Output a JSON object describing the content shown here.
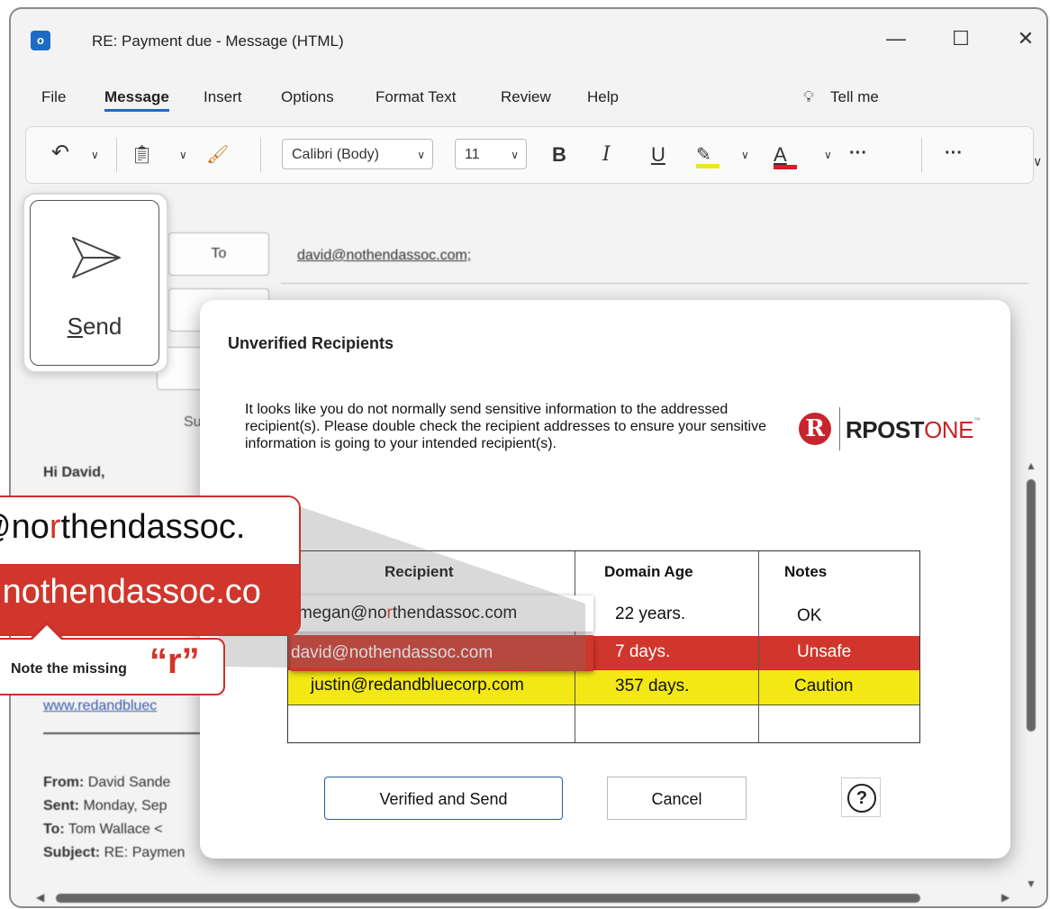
{
  "window": {
    "title": "RE: Payment due  -  Message (HTML)",
    "controls": {
      "minimize": "—",
      "maximize": "☐",
      "close": "✕"
    }
  },
  "menu": [
    "File",
    "Message",
    "Insert",
    "Options",
    "Format Text",
    "Review",
    "Help"
  ],
  "tell_me": "Tell me",
  "ribbon": {
    "font_name": "Calibri (Body)",
    "font_size": "11",
    "bold": "B",
    "italic": "I",
    "underline": "U",
    "font_color": "A",
    "more": "···",
    "more2": "···",
    "highlight_color": "#e9e81c",
    "font_color_bar": "#d21f2a"
  },
  "compose": {
    "to_button": "To",
    "to_address": "david@nothendassoc.com;",
    "subject_stub": "Su",
    "body": {
      "greeting": "Hi David,",
      "link": "www.redandbluec",
      "from_label": "From:",
      "from_value": "David Sande",
      "sent_label": "Sent:",
      "sent_value": "Monday, Sep",
      "to_label": "To:",
      "to_value": "Tom Wallace <",
      "subject_label": "Subject:",
      "subject_value": "RE: Paymen"
    }
  },
  "send": {
    "label": "Send"
  },
  "dialog": {
    "title": "Unverified Recipients",
    "message": "It looks like you do not normally send sensitive information to the addressed recipient(s). Please double check the recipient addresses to ensure your sensitive information is going to your intended recipient(s).",
    "logo": {
      "mark": "R",
      "text_dark": "RPOST",
      "text_red": "ONE",
      "tm": "™"
    },
    "table": {
      "headers": [
        "Recipient",
        "Domain Age",
        "Notes"
      ],
      "rows": [
        {
          "recipient_a": "megan@no",
          "recipient_b": "r",
          "recipient_c": "thendassoc.com",
          "age": "22 years.",
          "note": "OK",
          "status": "ok"
        },
        {
          "recipient": "david@nothendassoc.com",
          "age": "7 days.",
          "note": "Unsafe",
          "status": "unsafe"
        },
        {
          "recipient": "justin@redandbluecorp.com",
          "age": "357 days.",
          "note": "Caution",
          "status": "caution"
        }
      ]
    },
    "buttons": {
      "verify": "Verified and Send",
      "cancel": "Cancel",
      "help": "?"
    }
  },
  "callout": {
    "top_a": "@no",
    "top_b": "r",
    "top_c": "thendassoc.",
    "bottom": "@nothendassoc.co",
    "note": "Note the missing",
    "note_letter": "“r”"
  }
}
